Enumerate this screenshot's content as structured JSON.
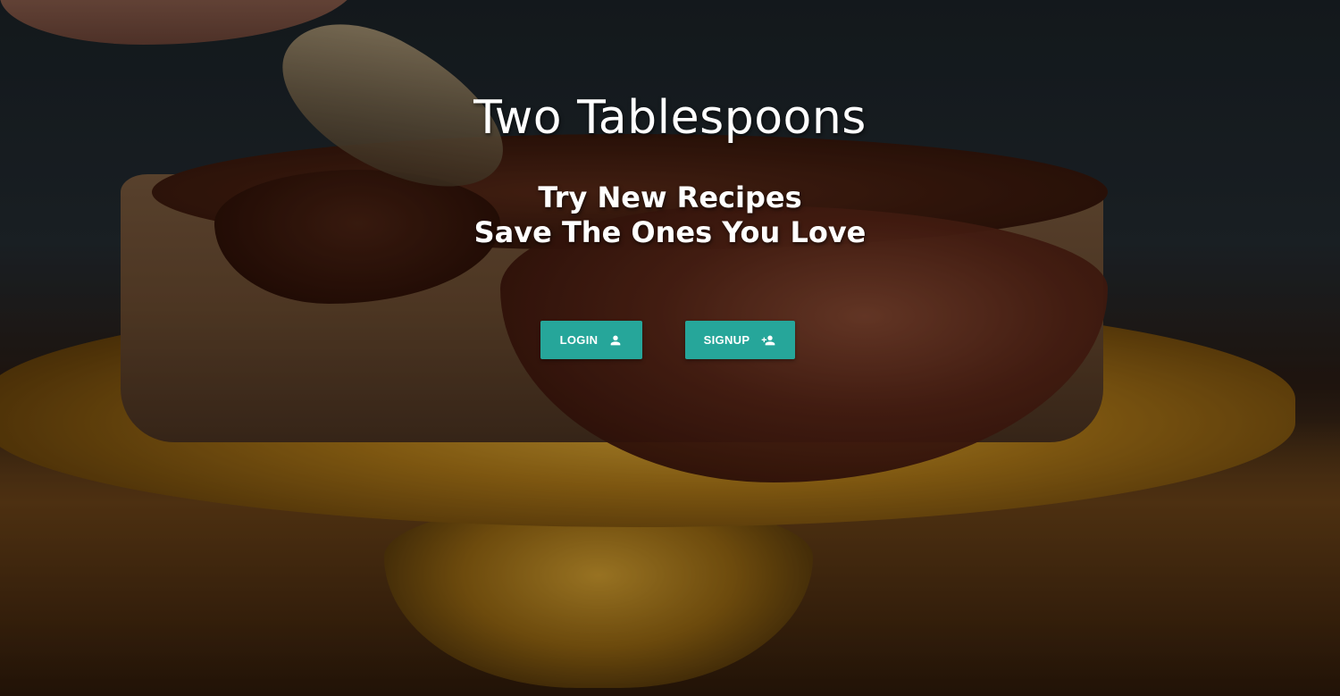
{
  "hero": {
    "title": "Two Tablespoons",
    "tagline_line1": "Try New Recipes",
    "tagline_line2": "Save The Ones You Love",
    "background_image": "chocolate-glazed-cake-on-gold-stand"
  },
  "actions": {
    "login_label": "LOGIN",
    "login_icon": "person-icon",
    "signup_label": "SIGNUP",
    "signup_icon": "person-add-icon"
  },
  "colors": {
    "button_bg": "#26a69a",
    "text": "#ffffff"
  }
}
